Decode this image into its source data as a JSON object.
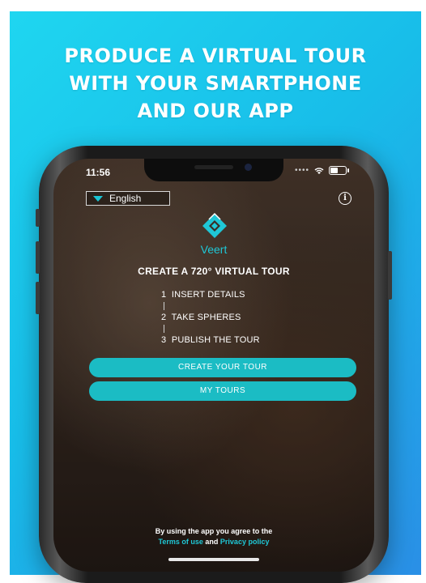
{
  "headline": {
    "line1": "PRODUCE A VIRTUAL TOUR",
    "line2": "WITH YOUR SMARTPHONE",
    "line3": "AND OUR APP"
  },
  "status_bar": {
    "time": "11:56"
  },
  "language_select": {
    "selected": "English"
  },
  "brand": {
    "name": "Veert"
  },
  "main": {
    "title": "CREATE A 720° VIRTUAL TOUR",
    "steps": [
      {
        "number": "1",
        "label": "INSERT DETAILS"
      },
      {
        "number": "2",
        "label": "TAKE SPHERES"
      },
      {
        "number": "3",
        "label": "PUBLISH THE TOUR"
      }
    ],
    "create_button_label": "CREATE YOUR TOUR",
    "my_tours_button_label": "MY TOURS"
  },
  "footer": {
    "agree_text": "By using the app you agree to the",
    "terms_link": "Terms of use",
    "and_text": "and",
    "privacy_link": "Privacy policy"
  },
  "colors": {
    "accent": "#1bbcc4",
    "background_top": "#1fd6f0",
    "background_bottom": "#2a8fe6"
  }
}
